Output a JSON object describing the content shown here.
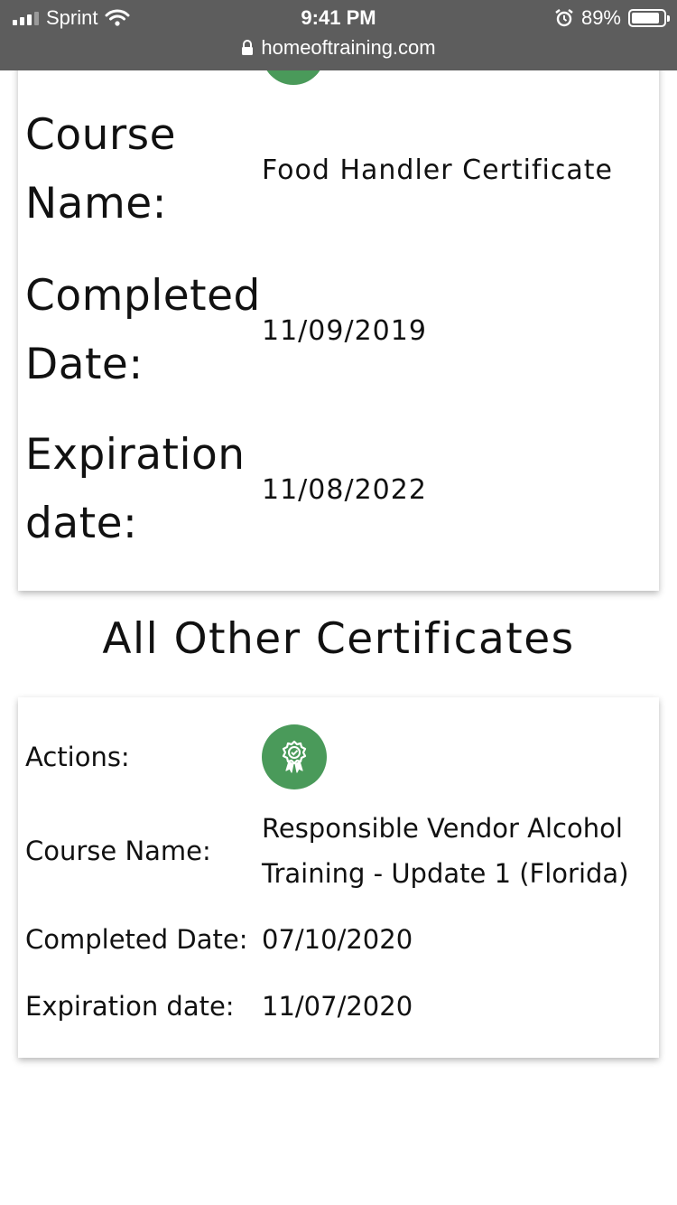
{
  "status_bar": {
    "carrier": "Sprint",
    "time": "9:41 PM",
    "battery": "89%",
    "battery_level": 0.89,
    "url": "homeoftraining.com"
  },
  "primary_certificate": {
    "course_name_label": "Course Name:",
    "course_name": "Food Handler Certificate",
    "completed_label": "Completed Date:",
    "completed_date": "11/09/2019",
    "expiration_label": "Expiration date:",
    "expiration_date": "11/08/2022"
  },
  "section_title": "All Other Certificates",
  "other_certificates": [
    {
      "actions_label": "Actions:",
      "action_icon": "certificate-award-icon",
      "course_name_label": "Course Name:",
      "course_name": "Responsible Vendor Alcohol Training - Update 1 (Florida)",
      "completed_label": "Completed Date:",
      "completed_date": "07/10/2020",
      "expiration_label": "Expiration date:",
      "expiration_date": "11/07/2020"
    }
  ],
  "colors": {
    "topbar": "#5d5d5d",
    "badge_green": "#4a9a5a"
  }
}
